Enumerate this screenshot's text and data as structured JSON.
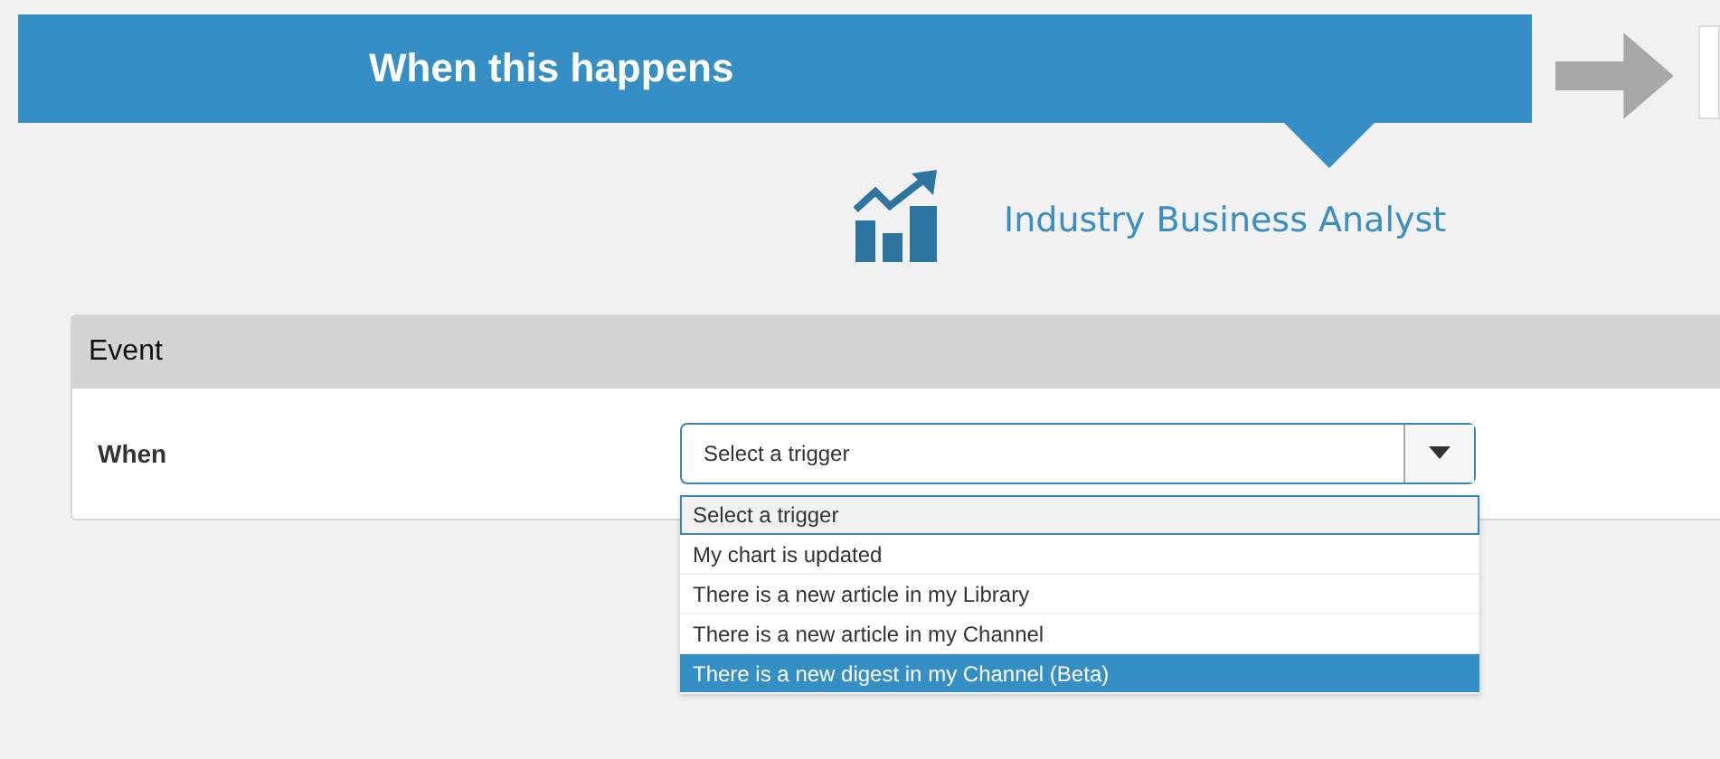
{
  "banner": {
    "title": "When this happens"
  },
  "app": {
    "name": "Industry Business Analyst"
  },
  "panel": {
    "title": "Event",
    "field_label": "When",
    "select": {
      "value": "Select a trigger",
      "open": true
    },
    "options": [
      {
        "label": "Select a trigger",
        "focused": true,
        "selected": false
      },
      {
        "label": "My chart is updated",
        "focused": false,
        "selected": false
      },
      {
        "label": "There is a new article in my Library",
        "focused": false,
        "selected": false
      },
      {
        "label": "There is a new article in my Channel",
        "focused": false,
        "selected": false
      },
      {
        "label": "There is a new digest in my Channel (Beta)",
        "focused": false,
        "selected": true
      }
    ]
  }
}
